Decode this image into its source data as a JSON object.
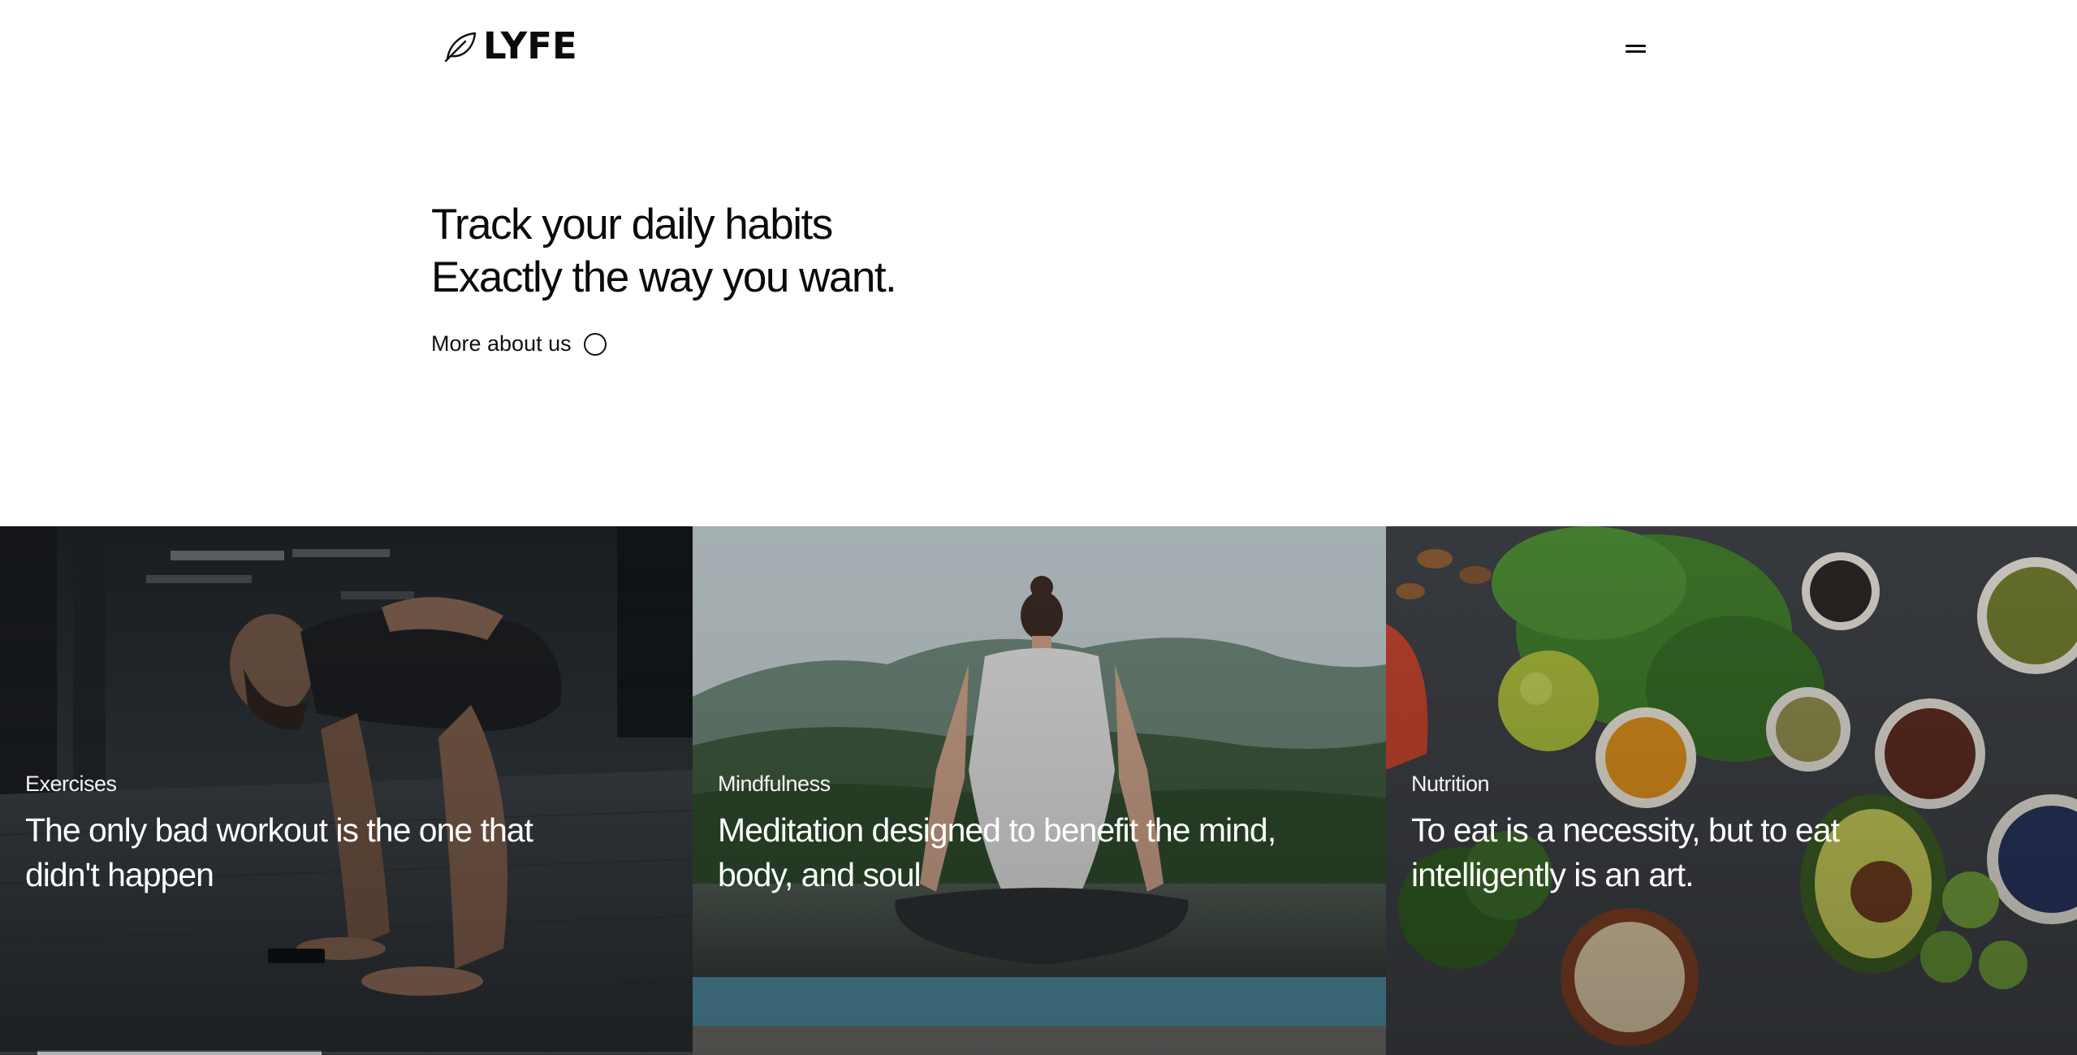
{
  "brand": {
    "name": "LYFE",
    "logo_icon": "leaf-icon"
  },
  "header": {
    "menu_icon": "hamburger-menu-icon"
  },
  "hero": {
    "title_line1": "Track your daily habits",
    "title_line2": "Exactly the way you want.",
    "more_link_label": "More about us",
    "more_link_icon": "circle-icon"
  },
  "cards": [
    {
      "category": "Exercises",
      "title": "The only bad workout is the one that didn't happen",
      "image": "man-doing-pushups-in-gym-photo"
    },
    {
      "category": "Mindfulness",
      "title": "Meditation designed to benefit the mind, body, and soul",
      "image": "woman-meditating-on-mountain-lake-photo"
    },
    {
      "category": "Nutrition",
      "title": "To eat is a necessity, but to eat intelligently is an art.",
      "image": "healthy-vegetables-and-grains-photo"
    }
  ],
  "carousel": {
    "progress": 0.41
  },
  "colors": {
    "text": "#0a0a0a",
    "background": "#ffffff",
    "card_text": "#ffffff"
  }
}
